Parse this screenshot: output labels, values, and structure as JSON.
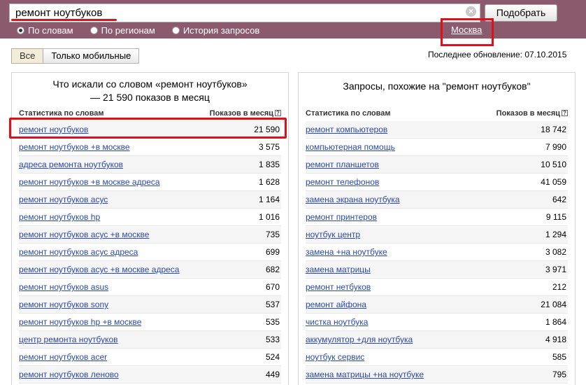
{
  "search": {
    "value": "ремонт ноутбуков",
    "submit_label": "Подобрать",
    "clear_symbol": "×"
  },
  "modes": [
    {
      "label": "По словам",
      "checked": true
    },
    {
      "label": "По регионам",
      "checked": false
    },
    {
      "label": "История запросов",
      "checked": false
    }
  ],
  "region": "Москва",
  "filters": {
    "all": "Все",
    "mobile": "Только мобильные"
  },
  "last_update": "Последнее обновление: 07.10.2015",
  "left_panel": {
    "title": "Что искали со словом «ремонт ноутбуков» — 21 590 показов в месяц",
    "col_words": "Статистика по словам",
    "col_views": "Показов в месяц",
    "rows": [
      {
        "q": "ремонт ноутбуков",
        "n": "21 590"
      },
      {
        "q": "ремонт ноутбуков +в москве",
        "n": "3 575"
      },
      {
        "q": "адреса ремонта ноутбуков",
        "n": "1 835"
      },
      {
        "q": "ремонт ноутбуков +в москве адреса",
        "n": "1 628"
      },
      {
        "q": "ремонт ноутбуков асус",
        "n": "1 164"
      },
      {
        "q": "ремонт ноутбуков hp",
        "n": "1 016"
      },
      {
        "q": "ремонт ноутбуков асус +в москве",
        "n": "735"
      },
      {
        "q": "ремонт ноутбуков асус адреса",
        "n": "699"
      },
      {
        "q": "ремонт ноутбуков асус +в москве адреса",
        "n": "682"
      },
      {
        "q": "ремонт ноутбуков asus",
        "n": "670"
      },
      {
        "q": "ремонт ноутбуков sony",
        "n": "537"
      },
      {
        "q": "ремонт ноутбуков hp +в москве",
        "n": "535"
      },
      {
        "q": "центр ремонта ноутбуков",
        "n": "533"
      },
      {
        "q": "ремонт ноутбуков acer",
        "n": "524"
      },
      {
        "q": "ремонт ноутбуков леново",
        "n": "449"
      }
    ]
  },
  "right_panel": {
    "title": "Запросы, похожие на \"ремонт ноутбуков\"",
    "col_words": "Статистика по словам",
    "col_views": "Показов в месяц",
    "rows": [
      {
        "q": "ремонт компьютеров",
        "n": "18 742"
      },
      {
        "q": "компьютерная помощь",
        "n": "7 990"
      },
      {
        "q": "ремонт планшетов",
        "n": "10 510"
      },
      {
        "q": "ремонт телефонов",
        "n": "41 059"
      },
      {
        "q": "замена экрана ноутбука",
        "n": "642"
      },
      {
        "q": "ремонт принтеров",
        "n": "9 115"
      },
      {
        "q": "ноутбук центр",
        "n": "1 294"
      },
      {
        "q": "замена +на ноутбуке",
        "n": "3 082"
      },
      {
        "q": "замена матрицы",
        "n": "3 971"
      },
      {
        "q": "ремонт нетбуков",
        "n": "212"
      },
      {
        "q": "ремонт айфона",
        "n": "21 084"
      },
      {
        "q": "чистка ноутбука",
        "n": "1 864"
      },
      {
        "q": "аккумулятор +для ноутбука",
        "n": "4 918"
      },
      {
        "q": "ноутбук сервис",
        "n": "585"
      },
      {
        "q": "замена матрицы +на ноутбуке",
        "n": "795"
      }
    ]
  },
  "colors": {
    "band": "#8b5a6d",
    "link": "#2a49a8",
    "highlight": "#e0101b"
  }
}
